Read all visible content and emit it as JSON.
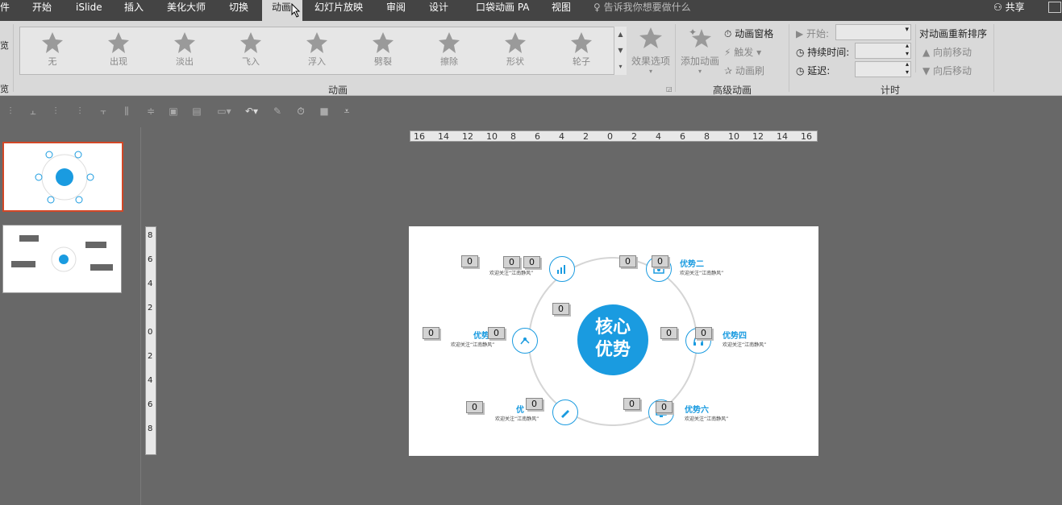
{
  "tabs": [
    {
      "label": "件"
    },
    {
      "label": "开始"
    },
    {
      "label": "iSlide"
    },
    {
      "label": "插入"
    },
    {
      "label": "美化大师"
    },
    {
      "label": "切换"
    },
    {
      "label": "动画"
    },
    {
      "label": "幻灯片放映"
    },
    {
      "label": "审阅"
    },
    {
      "label": "设计"
    },
    {
      "label": "口袋动画 PA"
    },
    {
      "label": "视图"
    }
  ],
  "tell_me": "告诉我你想要做什么",
  "share": "共享",
  "gallery": [
    {
      "label": "无",
      "icon": "star-none-icon"
    },
    {
      "label": "出现",
      "icon": "star-appear-icon"
    },
    {
      "label": "淡出",
      "icon": "star-fade-icon"
    },
    {
      "label": "飞入",
      "icon": "star-fly-icon"
    },
    {
      "label": "浮入",
      "icon": "star-float-icon"
    },
    {
      "label": "劈裂",
      "icon": "star-split-icon"
    },
    {
      "label": "擦除",
      "icon": "star-wipe-icon"
    },
    {
      "label": "形状",
      "icon": "star-shape-icon"
    },
    {
      "label": "轮子",
      "icon": "star-wheel-icon"
    }
  ],
  "groups": {
    "animation": "动画",
    "advanced": "高级动画",
    "timing": "计时"
  },
  "left_cut": {
    "top": "览",
    "bottom": "览"
  },
  "effect_options": "效果选项",
  "add_animation": "添加动画",
  "anim_pane": "动画窗格",
  "trigger": "触发",
  "anim_painter": "动画刷",
  "start_label": "开始:",
  "duration_label": "持续时间:",
  "delay_label": "延迟:",
  "reorder": "对动画重新排序",
  "move_earlier": "向前移动",
  "move_later": "向后移动",
  "ruler_h": [
    "16",
    "14",
    "12",
    "10",
    "8",
    "6",
    "4",
    "2",
    "0",
    "2",
    "4",
    "6",
    "8",
    "10",
    "12",
    "14",
    "16"
  ],
  "ruler_v": [
    "8",
    "6",
    "4",
    "2",
    "0",
    "2",
    "4",
    "6",
    "8"
  ],
  "slide": {
    "center_line1": "核心",
    "center_line2": "优势",
    "nodes": [
      {
        "title": "",
        "sub": "欢迎关注“江南静风”"
      },
      {
        "title": "优势二",
        "sub": "欢迎关注“江南静风”"
      },
      {
        "title": "优势",
        "sub": "欢迎关注“江南静风”"
      },
      {
        "title": "优势四",
        "sub": "欢迎关注“江南静风”"
      },
      {
        "title": "优",
        "sub": "欢迎关注“江南静风”"
      },
      {
        "title": "优势六",
        "sub": "欢迎关注“江南静风”"
      }
    ],
    "badge": "0"
  },
  "colors": {
    "accent": "#1a9be0",
    "ribbon": "#d9d9d9",
    "tabbar": "#444444",
    "workspace": "#686868",
    "selected_thumb": "#d24726"
  }
}
